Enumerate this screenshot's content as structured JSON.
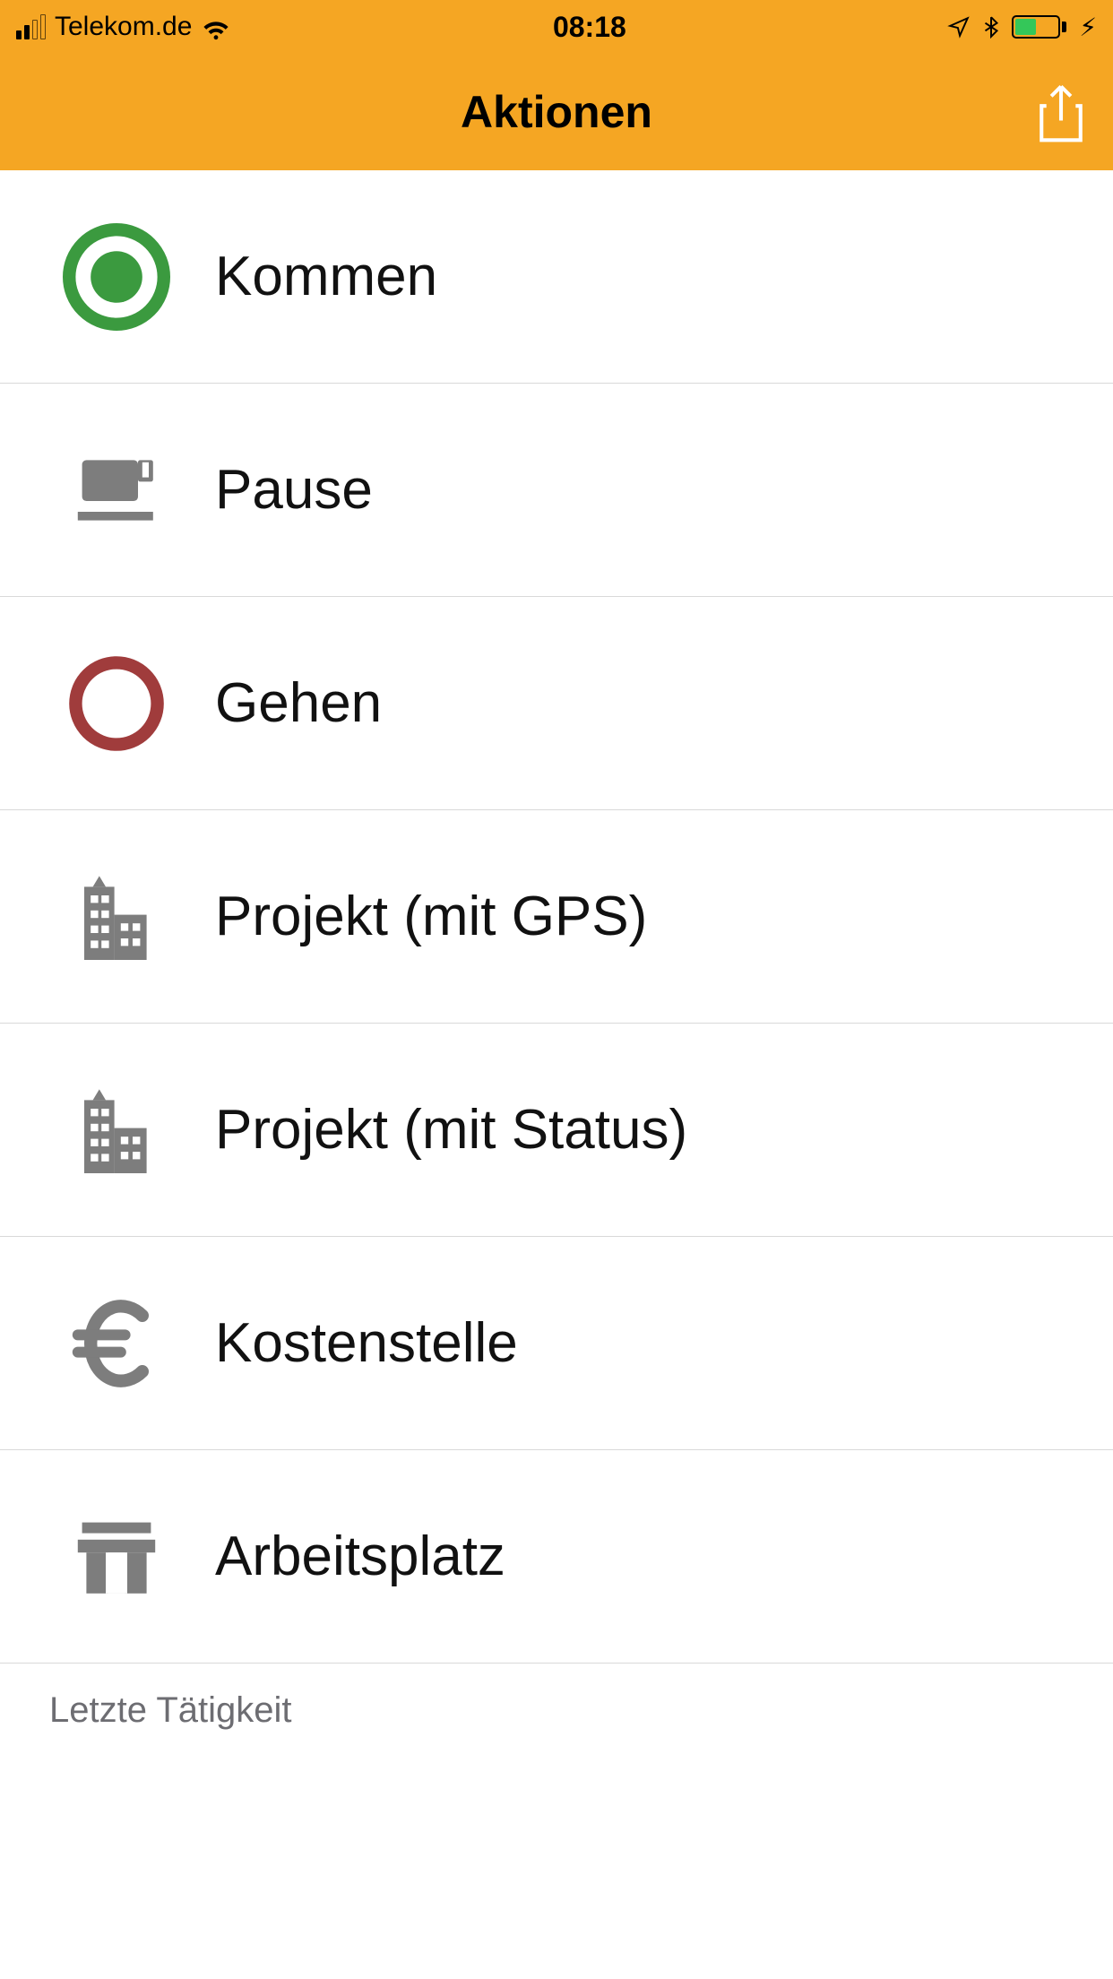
{
  "status": {
    "carrier": "Telekom.de",
    "time": "08:18"
  },
  "nav": {
    "title": "Aktionen"
  },
  "actions": [
    {
      "label": "Kommen"
    },
    {
      "label": "Pause"
    },
    {
      "label": "Gehen"
    },
    {
      "label": "Projekt (mit GPS)"
    },
    {
      "label": "Projekt (mit Status)"
    },
    {
      "label": "Kostenstelle"
    },
    {
      "label": "Arbeitsplatz"
    }
  ],
  "section": {
    "last_activity": "Letzte Tätigkeit"
  }
}
